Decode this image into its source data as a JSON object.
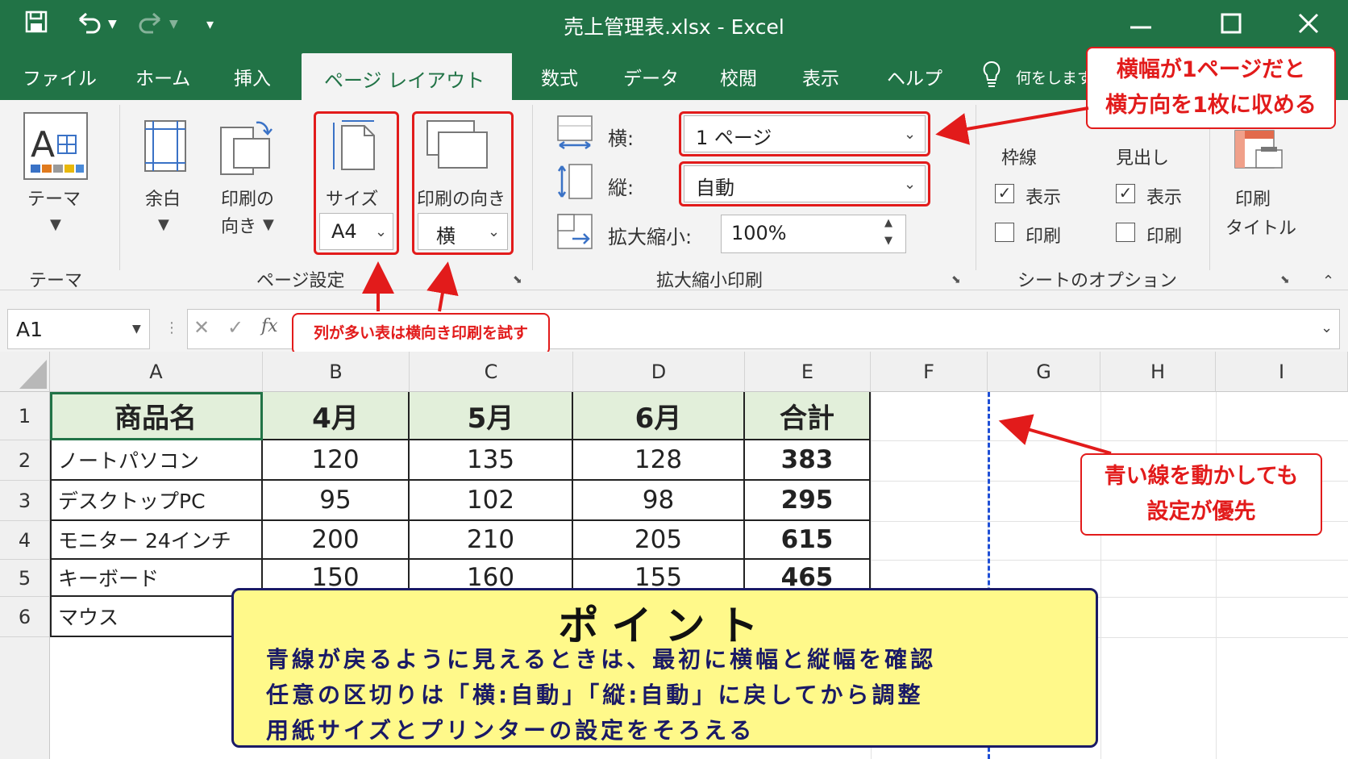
{
  "window": {
    "title": "売上管理表.xlsx  -  Excel"
  },
  "tabs": [
    "ファイル",
    "ホーム",
    "挿入",
    "ページ レイアウト",
    "数式",
    "データ",
    "校閲",
    "表示",
    "ヘルプ"
  ],
  "tell_me": "何をします",
  "ribbon": {
    "theme": {
      "label": "テーマ",
      "group": "テーマ"
    },
    "page_setup": {
      "margins": "余白",
      "orientation_line1": "印刷の",
      "orientation_line2": "向き",
      "size": "サイズ",
      "size_value": "A4",
      "print_orientation": "印刷の向き",
      "print_orientation_value": "横",
      "group": "ページ設定"
    },
    "scale": {
      "width_label": "横:",
      "width_value": "1 ページ",
      "height_label": "縦:",
      "height_value": "自動",
      "scale_label": "拡大縮小:",
      "scale_value": "100%",
      "group": "拡大縮小印刷"
    },
    "sheet_options": {
      "gridlines": "枠線",
      "headings": "見出し",
      "view": "表示",
      "print": "印刷",
      "group": "シートのオプション",
      "gridlines_view": true,
      "gridlines_print": false,
      "headings_view": true,
      "headings_print": false
    },
    "print_titles": {
      "line1": "印刷",
      "line2": "タイトル"
    }
  },
  "callouts": {
    "fit_width": [
      "横幅が1ページだと",
      "横方向を1枚に収める"
    ],
    "landscape": "列が多い表は横向き印刷を試す",
    "blue_line": [
      "青い線を動かしても",
      "設定が優先"
    ]
  },
  "formula_bar": {
    "name_box": "A1",
    "fx": "fx"
  },
  "columns": [
    "A",
    "B",
    "C",
    "D",
    "E",
    "F",
    "G",
    "H",
    "I"
  ],
  "rows": [
    "1",
    "2",
    "3",
    "4",
    "5",
    "6"
  ],
  "table": {
    "headers": [
      "商品名",
      "4月",
      "5月",
      "6月",
      "合計"
    ],
    "rows": [
      [
        "ノートパソコン",
        "120",
        "135",
        "128",
        "383"
      ],
      [
        "デスクトップPC",
        "95",
        "102",
        "98",
        "295"
      ],
      [
        "モニター 24インチ",
        "200",
        "210",
        "205",
        "615"
      ],
      [
        "キーボード",
        "150",
        "160",
        "155",
        "465"
      ],
      [
        "マウス",
        "",
        "",
        "",
        ""
      ]
    ]
  },
  "point": {
    "title": "ポイント",
    "lines": [
      "青線が戻るように見えるときは、最初に横幅と縦幅を確認",
      "任意の区切りは「横:自動」「縦:自動」に戻してから調整",
      "用紙サイズとプリンターの設定をそろえる"
    ]
  },
  "colors": {
    "excel_green": "#217346",
    "callout_red": "#e21b1b",
    "header_fill": "#e2efda",
    "point_fill": "#fff98a",
    "page_break_blue": "#1f4fd6"
  }
}
